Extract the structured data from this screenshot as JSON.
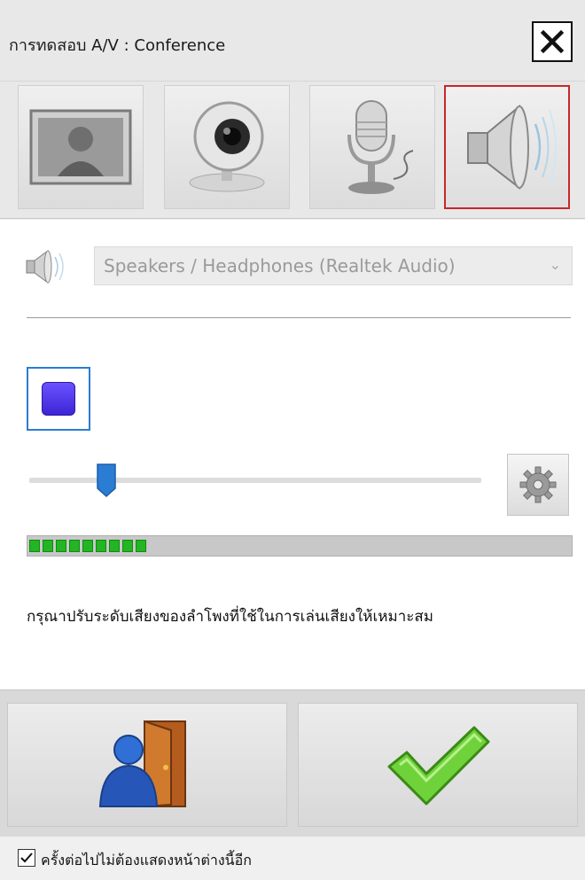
{
  "window": {
    "title": "การทดสอบ A/V : Conference",
    "close_label": "X"
  },
  "tabs": [
    {
      "name": "video-preview",
      "icon": "user-photo-icon",
      "active": false
    },
    {
      "name": "webcam",
      "icon": "webcam-icon",
      "active": false
    },
    {
      "name": "microphone",
      "icon": "microphone-icon",
      "active": false
    },
    {
      "name": "speaker",
      "icon": "speaker-icon",
      "active": true
    }
  ],
  "speaker": {
    "device_icon": "speaker-icon",
    "selected_device": "Speakers / Headphones (Realtek Audio)",
    "volume_fraction": 0.17,
    "level_segments_lit": 9,
    "instruction": "กรุณาปรับระดับเสียงของลำโพงที่ใช้ในการเล่นเสียงให้เหมาะสม"
  },
  "footer": {
    "exit_icon": "exit-door-icon",
    "confirm_icon": "checkmark-icon",
    "dont_show_again": "ครั้งต่อไปไม่ต้องแสดงหน้าต่างนี้อีก",
    "dont_show_checked": true
  },
  "colors": {
    "active_tab_border": "#c62828",
    "stop_button": "#4a33e6",
    "level_green": "#23b523",
    "focus_blue": "#2b7cd3"
  }
}
